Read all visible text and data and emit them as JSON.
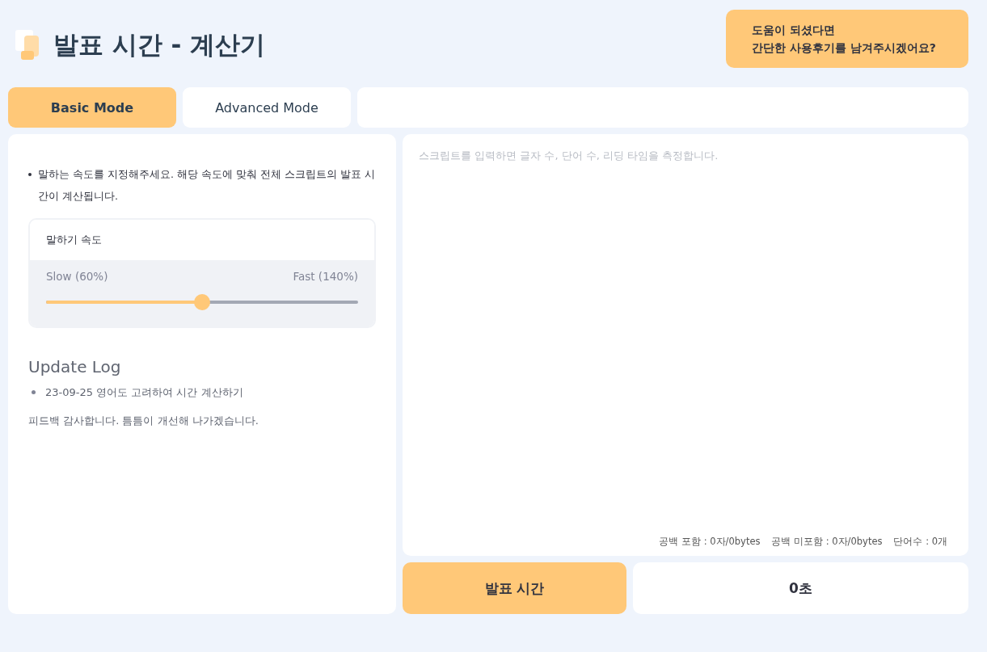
{
  "header": {
    "title": "발표 시간 - 계산기",
    "feedback_button": [
      "도움이 되셨다면",
      "간단한 사용후기를 남겨주시겠어요?"
    ]
  },
  "tabs": [
    {
      "label": "Basic Mode",
      "selected": true
    },
    {
      "label": "Advanced Mode",
      "selected": false
    }
  ],
  "settings": {
    "instruction": "말하는 속도를 지정해주세요. 해당 속도에 맞춰 전체 스크립트의 발표 시간이 계산됩니다.",
    "speed_card": {
      "title": "말하기 속도",
      "min_label": "Slow (60%)",
      "max_label": "Fast (140%)",
      "level": 0.5
    }
  },
  "update_log": {
    "heading": "Update Log",
    "items": [
      "23-09-25 영어도 고려하여 시간 계산하기"
    ],
    "note": "피드백 감사합니다. 틈틈이 개선해 나가겠습니다."
  },
  "script": {
    "placeholder": "스크립트를 입력하면 글자 수, 단어 수, 리딩 타임을 측정합니다.",
    "stats": [
      "공백 포함 : 0자/0bytes",
      "공백 미포함 : 0자/0bytes",
      "단어수 : 0개"
    ]
  },
  "result": {
    "label": "발표 시간",
    "value": "0초"
  }
}
